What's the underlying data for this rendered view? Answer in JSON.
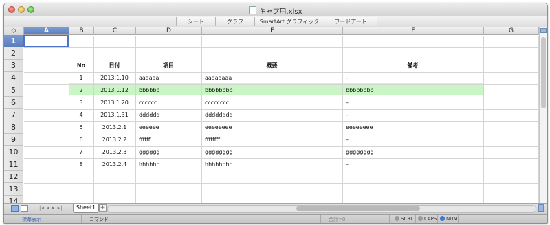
{
  "window": {
    "title": "キャプ用.xlsx",
    "ribbon_tabs": [
      "シート",
      "グラフ",
      "SmartArt グラフィック",
      "ワードアート"
    ]
  },
  "grid": {
    "corner_symbol": "◇",
    "columns": [
      "A",
      "B",
      "C",
      "D",
      "E",
      "F",
      "G"
    ],
    "selected_column": "A",
    "rows": [
      "1",
      "2",
      "3",
      "4",
      "5",
      "6",
      "7",
      "8",
      "9",
      "10",
      "11",
      "12",
      "13",
      "14"
    ],
    "selected_row": "1",
    "selected_cell": "A1",
    "highlight_row": "5",
    "headers": {
      "no": "No",
      "date": "日付",
      "item": "項目",
      "summary": "概要",
      "notes": "備考"
    },
    "records": [
      {
        "no": "1",
        "date": "2013.1.10",
        "item": "aaaaaa",
        "summary": "aaaaaaaa",
        "notes": "–"
      },
      {
        "no": "2",
        "date": "2013.1.12",
        "item": "bbbbbb",
        "summary": "bbbbbbbb",
        "notes": "bbbbbbbb"
      },
      {
        "no": "3",
        "date": "2013.1.20",
        "item": "cccccc",
        "summary": "cccccccc",
        "notes": "–"
      },
      {
        "no": "4",
        "date": "2013.1.31",
        "item": "dddddd",
        "summary": "dddddddd",
        "notes": "–"
      },
      {
        "no": "5",
        "date": "2013.2.1",
        "item": "eeeeee",
        "summary": "eeeeeeee",
        "notes": "eeeeeeee"
      },
      {
        "no": "6",
        "date": "2013.2.2",
        "item": "ffffff",
        "summary": "ffffffff",
        "notes": "–"
      },
      {
        "no": "7",
        "date": "2013.2.3",
        "item": "gggggg",
        "summary": "gggggggg",
        "notes": "gggggggg"
      },
      {
        "no": "8",
        "date": "2013.2.4",
        "item": "hhhhhh",
        "summary": "hhhhhhhh",
        "notes": "–"
      }
    ]
  },
  "sheets": {
    "nav_arrows": "|◂ ◂ ▸ ▸|",
    "tabs": [
      "Sheet1"
    ],
    "add_label": "+"
  },
  "status": {
    "view_mode": "標準表示",
    "mode": "コマンド",
    "sum": "合計=0",
    "scrl": "SCRL",
    "caps": "CAPS",
    "num": "NUM"
  },
  "colors": {
    "highlight": "#c9f6c4",
    "selection": "#4a73c9"
  }
}
